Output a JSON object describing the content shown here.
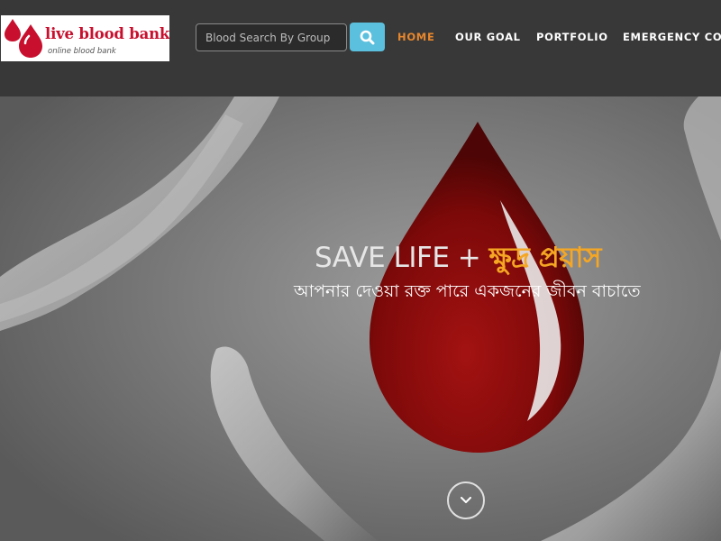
{
  "logo": {
    "title": "live blood bank",
    "tagline": "online blood bank"
  },
  "search": {
    "placeholder": "Blood Search By Group",
    "button_icon": "search-icon"
  },
  "nav": {
    "items": [
      "HOME",
      "OUR GOAL",
      "PORTFOLIO",
      "EMERGENCY CONT"
    ],
    "active_index": 0,
    "active_color": "#e8872c"
  },
  "hero": {
    "headline_prefix": "SAVE LIFE + ",
    "headline_accent": "ক্ষুদ্র প্রয়াস",
    "subline": "আপনার দেওয়া রক্ত পারে একজনের জীবন বাচাতে",
    "scroll_icon": "chevron-down-icon",
    "accent_color": "#f5a623",
    "drop_color": "#8b0a0a"
  }
}
